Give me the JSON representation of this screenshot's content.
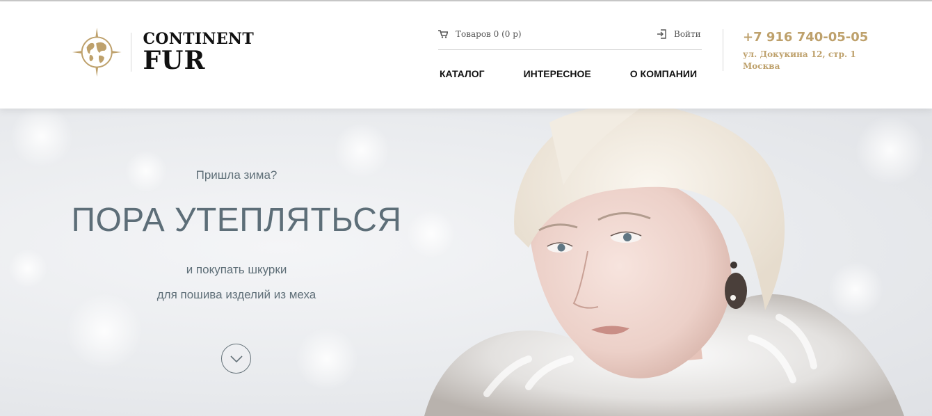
{
  "colors": {
    "accent_gold": "#bea16c",
    "hero_text": "#5d6e78",
    "nav_text": "#111111"
  },
  "header": {
    "logo": {
      "line1": "CONTINENT",
      "line2": "FUR",
      "emblem_icon": "globe-compass-icon"
    },
    "cart": {
      "icon": "cart-icon",
      "label": "Товаров 0 (0 р)"
    },
    "login": {
      "icon": "login-icon",
      "label": "Войти"
    },
    "nav": [
      {
        "label": "КАТАЛОГ"
      },
      {
        "label": "ИНТЕРЕСНОЕ"
      },
      {
        "label": "О КОМПАНИИ"
      }
    ],
    "contact": {
      "phone": "+7 916 740-05-05",
      "address_line1": "ул. Докукина 12, стр. 1",
      "address_line2": "Москва"
    }
  },
  "hero": {
    "kicker": "Пришла зима?",
    "title": "ПОРА УТЕПЛЯТЬСЯ",
    "subtitle_line1": "и покупать шкурки",
    "subtitle_line2": "для пошива изделий из меха",
    "scroll_icon": "chevron-down-icon"
  }
}
